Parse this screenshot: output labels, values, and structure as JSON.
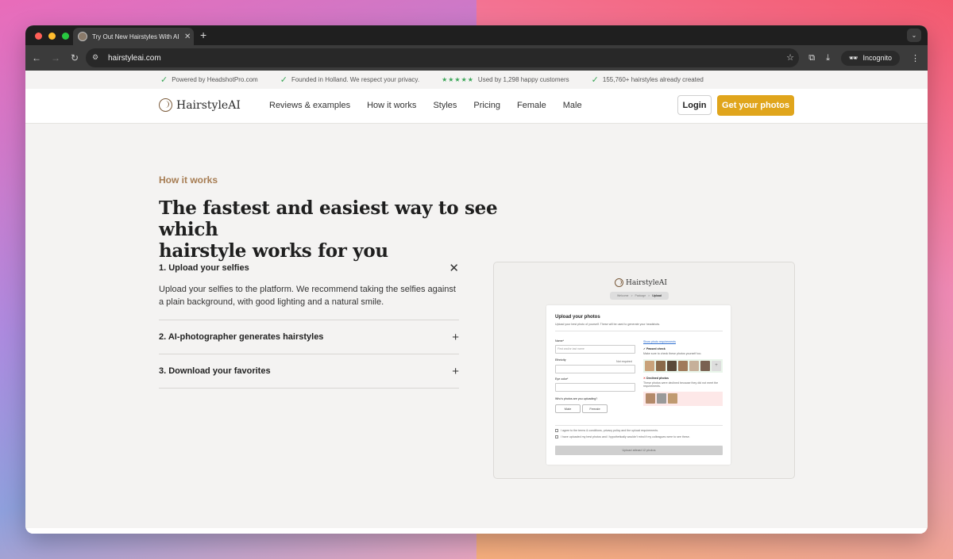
{
  "browser": {
    "tab_title": "Try Out New Hairstyles With AI",
    "new_tab": "+",
    "url": "hairstyleai.com",
    "incognito_label": "Incognito"
  },
  "trustbar": {
    "items": [
      "Powered by HeadshotPro.com",
      "Founded in Holland. We respect your privacy.",
      "Used by 1,298 happy customers",
      "155,760+ hairstyles already created"
    ],
    "stars": "★★★★★"
  },
  "nav": {
    "logo": "HairstyleAI",
    "links": [
      "Reviews & examples",
      "How it works",
      "Styles",
      "Pricing",
      "Female",
      "Male"
    ],
    "login": "Login",
    "cta": "Get your photos"
  },
  "section": {
    "eyebrow": "How it works",
    "headline_line1": "The fastest and easiest way to see which",
    "headline_line2": "hairstyle works for you"
  },
  "accordion": [
    {
      "title": "1. Upload your selfies",
      "icon": "✕",
      "body": "Upload your selfies to the platform. We recommend taking the selfies against a plain background, with good lighting and a natural smile.",
      "open": true
    },
    {
      "title": "2. AI-photographer generates hairstyles",
      "icon": "+",
      "open": false
    },
    {
      "title": "3. Download your favorites",
      "icon": "+",
      "open": false
    }
  ],
  "preview": {
    "logo": "HairstyleAI",
    "crumbs": [
      "Welcome",
      ">",
      "Package",
      ">",
      "Upload"
    ],
    "title": "Upload your photos",
    "subtitle": "Upload your best photo of yourself. These will be used to generate your headshots.",
    "name_label": "Name*",
    "name_placeholder": "First and/or last name",
    "ethnicity_label": "Ethnicity",
    "not_required": "Not required",
    "eye_label": "Eye color*",
    "uploading_label": "Who's photos are you uploading?",
    "male": "Male",
    "female": "Female",
    "requirements_link": "Show photo requirements",
    "passed_check": "Passed check",
    "passed_sub": "Make sure to check these photos yourself too.",
    "declined": "Declined photos",
    "declined_sub": "These photos were declined because they did not meet the requirements.",
    "agree_text": "I agree to the terms & conditions, privacy policy and the upload requirements.",
    "uploaded_text": "I have uploaded my best photos and I hypothetically wouldn't mind if my colleagues were to see these.",
    "submit": "Upload atleast 12 photos",
    "thumb_colors": [
      "#c9a27a",
      "#8a6a4a",
      "#5a4a3a",
      "#a07a5a",
      "#c6b09a",
      "#7a6252"
    ],
    "declined_colors": [
      "#b48a6a",
      "#9a9a9a",
      "#c09a70"
    ]
  }
}
